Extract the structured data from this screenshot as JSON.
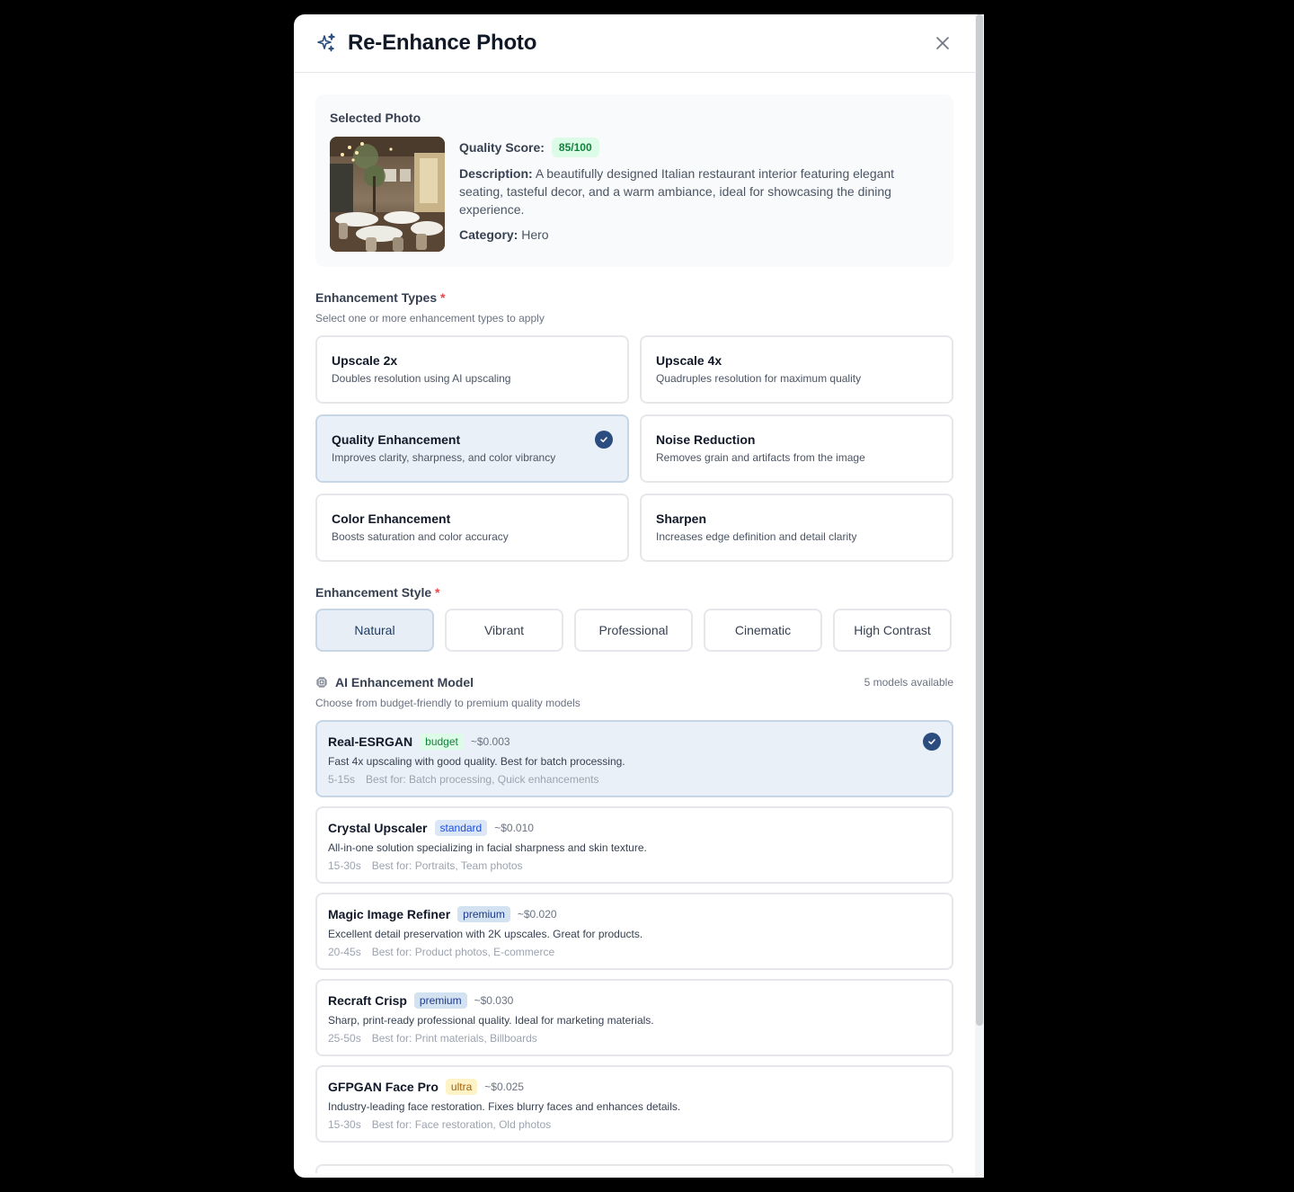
{
  "header": {
    "title": "Re-Enhance Photo",
    "icon": "sparkles-icon",
    "close_icon": "close-icon"
  },
  "photo": {
    "section_label": "Selected Photo",
    "quality_label": "Quality Score:",
    "quality_value": "85/100",
    "description_label": "Description:",
    "description": "A beautifully designed Italian restaurant interior featuring elegant seating, tasteful decor, and a warm ambiance, ideal for showcasing the dining experience.",
    "category_label": "Category:",
    "category": "Hero"
  },
  "enhancement_types": {
    "title": "Enhancement Types",
    "required_mark": "*",
    "hint": "Select one or more enhancement types to apply",
    "items": [
      {
        "title": "Upscale 2x",
        "desc": "Doubles resolution using AI upscaling",
        "selected": false
      },
      {
        "title": "Upscale 4x",
        "desc": "Quadruples resolution for maximum quality",
        "selected": false
      },
      {
        "title": "Quality Enhancement",
        "desc": "Improves clarity, sharpness, and color vibrancy",
        "selected": true
      },
      {
        "title": "Noise Reduction",
        "desc": "Removes grain and artifacts from the image",
        "selected": false
      },
      {
        "title": "Color Enhancement",
        "desc": "Boosts saturation and color accuracy",
        "selected": false
      },
      {
        "title": "Sharpen",
        "desc": "Increases edge definition and detail clarity",
        "selected": false
      }
    ]
  },
  "enhancement_style": {
    "title": "Enhancement Style",
    "required_mark": "*",
    "options": [
      "Natural",
      "Vibrant",
      "Professional",
      "Cinematic",
      "High Contrast"
    ],
    "selected": "Natural"
  },
  "models": {
    "title": "AI Enhancement Model",
    "icon": "cpu-chip-icon",
    "count": "5 models available",
    "hint": "Choose from budget-friendly to premium quality models",
    "items": [
      {
        "name": "Real-ESRGAN",
        "tier": "budget",
        "price": "~$0.003",
        "desc": "Fast 4x upscaling with good quality. Best for batch processing.",
        "time": "5-15s",
        "best": "Best for: Batch processing, Quick enhancements",
        "selected": true
      },
      {
        "name": "Crystal Upscaler",
        "tier": "standard",
        "price": "~$0.010",
        "desc": "All-in-one solution specializing in facial sharpness and skin texture.",
        "time": "15-30s",
        "best": "Best for: Portraits, Team photos",
        "selected": false
      },
      {
        "name": "Magic Image Refiner",
        "tier": "premium",
        "price": "~$0.020",
        "desc": "Excellent detail preservation with 2K upscales. Great for products.",
        "time": "20-45s",
        "best": "Best for: Product photos, E-commerce",
        "selected": false
      },
      {
        "name": "Recraft Crisp",
        "tier": "premium",
        "price": "~$0.030",
        "desc": "Sharp, print-ready professional quality. Ideal for marketing materials.",
        "time": "25-50s",
        "best": "Best for: Print materials, Billboards",
        "selected": false
      },
      {
        "name": "GFPGAN Face Pro",
        "tier": "ultra",
        "price": "~$0.025",
        "desc": "Industry-leading face restoration. Fixes blurry faces and enhances details.",
        "time": "15-30s",
        "best": "Best for: Face restoration, Old photos",
        "selected": false
      }
    ]
  },
  "colors": {
    "accent": "#2b4c7e",
    "selected_bg": "#eaf0f7",
    "required": "#ef4444"
  }
}
